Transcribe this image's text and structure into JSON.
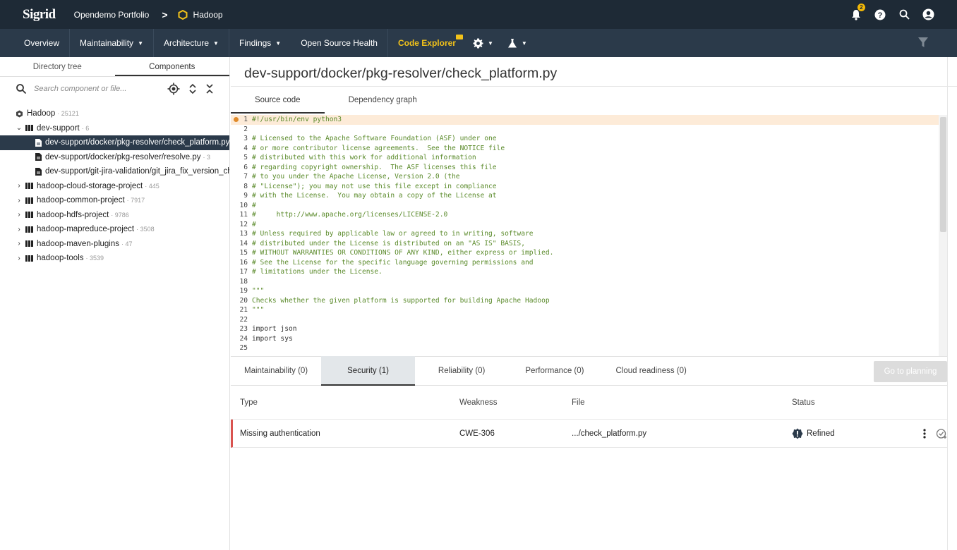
{
  "topbar": {
    "logo": "Sigrid",
    "portfolio": "Opendemo Portfolio",
    "separator": ">",
    "project": "Hadoop",
    "notification_count": "2"
  },
  "nav": {
    "items": [
      {
        "label": "Overview",
        "dropdown": false
      },
      {
        "label": "Maintainability",
        "dropdown": true
      },
      {
        "label": "Architecture",
        "dropdown": true
      },
      {
        "label": "Findings",
        "dropdown": true
      },
      {
        "label": "Open Source Health",
        "dropdown": false
      },
      {
        "label": "Code Explorer",
        "dropdown": false
      }
    ]
  },
  "left": {
    "tabs": [
      "Directory tree",
      "Components"
    ],
    "active_tab": "Components",
    "search_placeholder": "Search component or file...",
    "tree": {
      "root": {
        "label": "Hadoop",
        "count": "· 25121"
      },
      "dev_support": {
        "label": "dev-support",
        "count": "· 6"
      },
      "files": [
        {
          "label": "dev-support/docker/pkg-resolver/check_platform.py",
          "count": ""
        },
        {
          "label": "dev-support/docker/pkg-resolver/resolve.py",
          "count": "· 3"
        },
        {
          "label": "dev-support/git-jira-validation/git_jira_fix_version_check.py",
          "count": ""
        }
      ],
      "components": [
        {
          "label": "hadoop-cloud-storage-project",
          "count": "· 445"
        },
        {
          "label": "hadoop-common-project",
          "count": "· 7917"
        },
        {
          "label": "hadoop-hdfs-project",
          "count": "· 9786"
        },
        {
          "label": "hadoop-mapreduce-project",
          "count": "· 3508"
        },
        {
          "label": "hadoop-maven-plugins",
          "count": "· 47"
        },
        {
          "label": "hadoop-tools",
          "count": "· 3539"
        }
      ]
    }
  },
  "main": {
    "file_title": "dev-support/docker/pkg-resolver/check_platform.py",
    "subtabs": [
      "Source code",
      "Dependency graph"
    ],
    "code_lines": [
      "#!/usr/bin/env python3",
      "",
      "# Licensed to the Apache Software Foundation (ASF) under one",
      "# or more contributor license agreements.  See the NOTICE file",
      "# distributed with this work for additional information",
      "# regarding copyright ownership.  The ASF licenses this file",
      "# to you under the Apache License, Version 2.0 (the",
      "# \"License\"); you may not use this file except in compliance",
      "# with the License.  You may obtain a copy of the License at",
      "#",
      "#     http://www.apache.org/licenses/LICENSE-2.0",
      "#",
      "# Unless required by applicable law or agreed to in writing, software",
      "# distributed under the License is distributed on an \"AS IS\" BASIS,",
      "# WITHOUT WARRANTIES OR CONDITIONS OF ANY KIND, either express or implied.",
      "# See the License for the specific language governing permissions and",
      "# limitations under the License.",
      "",
      "\"\"\"",
      "Checks whether the given platform is supported for building Apache Hadoop",
      "\"\"\"",
      "",
      "import json",
      "import sys",
      ""
    ],
    "findings_tabs": [
      "Maintainability (0)",
      "Security (1)",
      "Reliability (0)",
      "Performance (0)",
      "Cloud readiness (0)"
    ],
    "plan_button": "Go to planning",
    "table": {
      "headers": {
        "type": "Type",
        "weakness": "Weakness",
        "file": "File",
        "status": "Status"
      },
      "rows": [
        {
          "type": "Missing authentication",
          "weakness": "CWE-306",
          "file": ".../check_platform.py",
          "status": "Refined"
        }
      ]
    }
  },
  "colors": {
    "topbar": "#1e2a36",
    "navbar": "#2b3a4a",
    "accent": "#f2c21a",
    "severity": "#d9534f"
  }
}
